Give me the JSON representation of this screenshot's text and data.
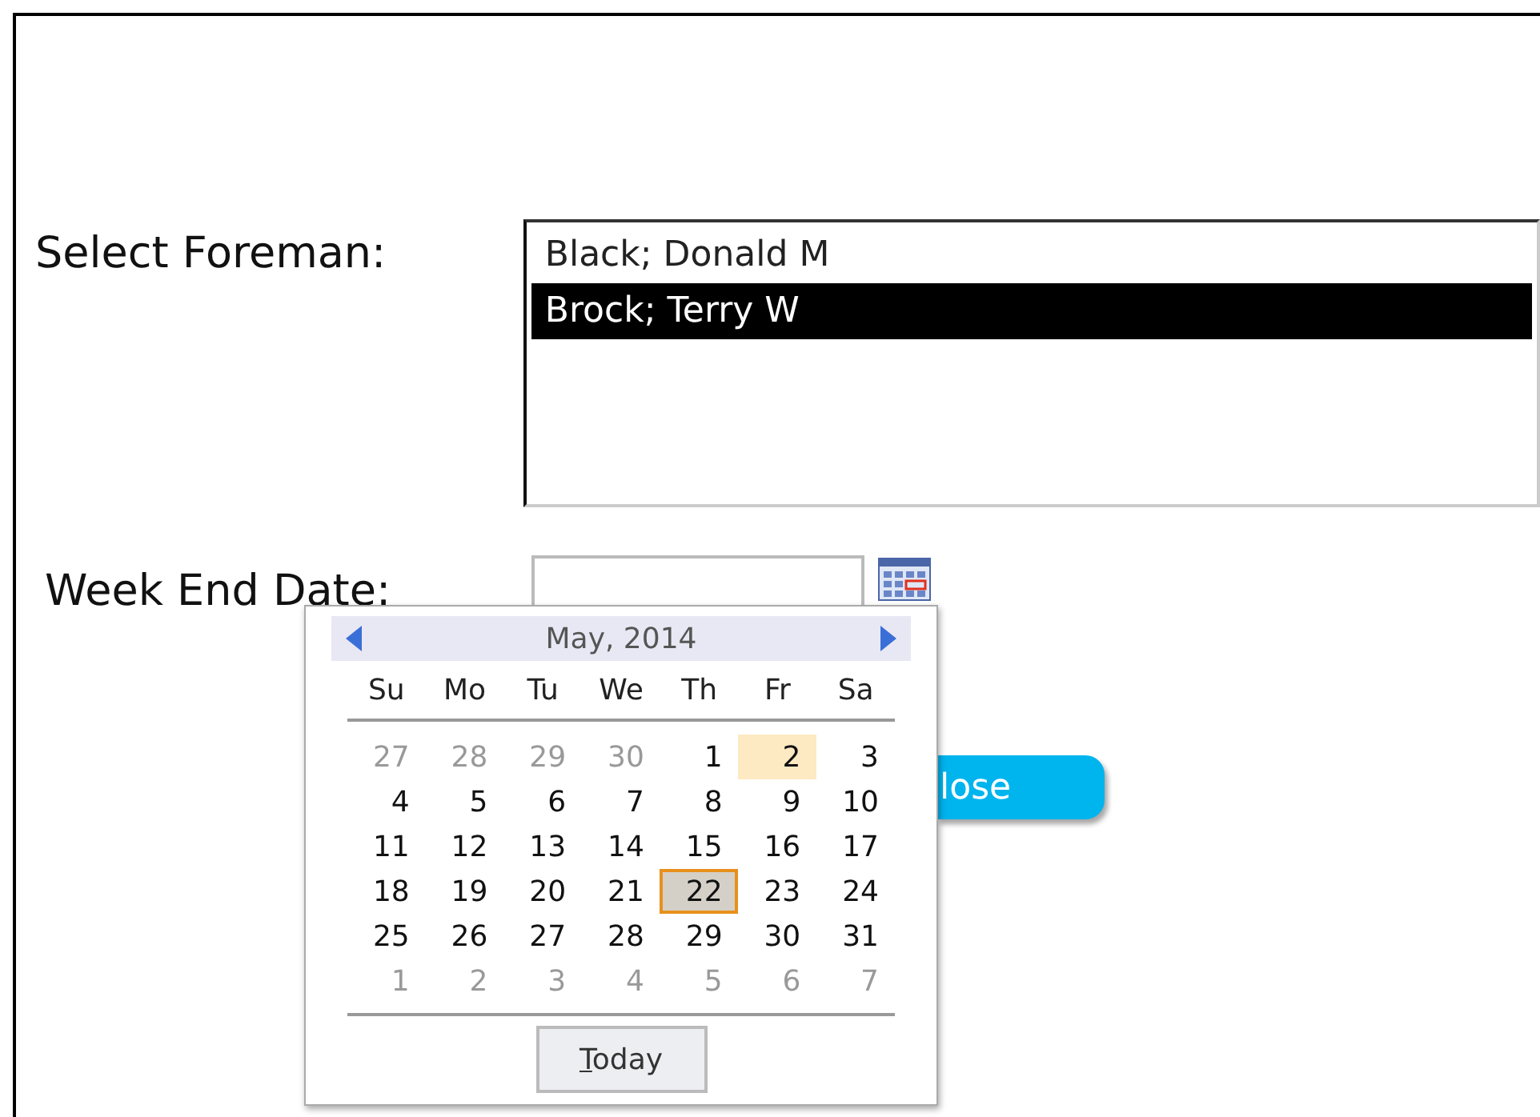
{
  "form": {
    "foreman_label": "Select Foreman:",
    "foreman_list": [
      {
        "text": "Black; Donald M",
        "selected": false
      },
      {
        "text": "Brock; Terry W",
        "selected": true
      }
    ],
    "week_end_label": "Week End Date:",
    "close_button": "lose"
  },
  "calendar": {
    "month": "May, 2014",
    "weekdays": [
      "Su",
      "Mo",
      "Tu",
      "We",
      "Th",
      "Fr",
      "Sa"
    ],
    "weeks": [
      [
        {
          "day": "27",
          "kind": "other",
          "selected": false
        },
        {
          "day": "28",
          "kind": "other",
          "selected": false
        },
        {
          "day": "29",
          "kind": "other",
          "selected": false
        },
        {
          "day": "30",
          "kind": "other",
          "selected": false
        },
        {
          "day": "1",
          "kind": "day",
          "selected": false
        },
        {
          "day": "2",
          "kind": "today",
          "selected": false
        },
        {
          "day": "3",
          "kind": "day",
          "selected": false
        }
      ],
      [
        {
          "day": "4",
          "kind": "day",
          "selected": false
        },
        {
          "day": "5",
          "kind": "day",
          "selected": false
        },
        {
          "day": "6",
          "kind": "day",
          "selected": false
        },
        {
          "day": "7",
          "kind": "day",
          "selected": false
        },
        {
          "day": "8",
          "kind": "day",
          "selected": false
        },
        {
          "day": "9",
          "kind": "day",
          "selected": false
        },
        {
          "day": "10",
          "kind": "day",
          "selected": false
        }
      ],
      [
        {
          "day": "11",
          "kind": "day",
          "selected": false
        },
        {
          "day": "12",
          "kind": "day",
          "selected": false
        },
        {
          "day": "13",
          "kind": "day",
          "selected": false
        },
        {
          "day": "14",
          "kind": "day",
          "selected": false
        },
        {
          "day": "15",
          "kind": "day",
          "selected": false
        },
        {
          "day": "16",
          "kind": "day",
          "selected": false
        },
        {
          "day": "17",
          "kind": "day",
          "selected": false
        }
      ],
      [
        {
          "day": "18",
          "kind": "day",
          "selected": false
        },
        {
          "day": "19",
          "kind": "day",
          "selected": false
        },
        {
          "day": "20",
          "kind": "day",
          "selected": false
        },
        {
          "day": "21",
          "kind": "day",
          "selected": false
        },
        {
          "day": "22",
          "kind": "day",
          "selected": true
        },
        {
          "day": "23",
          "kind": "day",
          "selected": false
        },
        {
          "day": "24",
          "kind": "day",
          "selected": false
        }
      ],
      [
        {
          "day": "25",
          "kind": "day",
          "selected": false
        },
        {
          "day": "26",
          "kind": "day",
          "selected": false
        },
        {
          "day": "27",
          "kind": "day",
          "selected": false
        },
        {
          "day": "28",
          "kind": "day",
          "selected": false
        },
        {
          "day": "29",
          "kind": "day",
          "selected": false
        },
        {
          "day": "30",
          "kind": "day",
          "selected": false
        },
        {
          "day": "31",
          "kind": "day",
          "selected": false
        }
      ],
      [
        {
          "day": "1",
          "kind": "other",
          "selected": false
        },
        {
          "day": "2",
          "kind": "other",
          "selected": false
        },
        {
          "day": "3",
          "kind": "other",
          "selected": false
        },
        {
          "day": "4",
          "kind": "other",
          "selected": false
        },
        {
          "day": "5",
          "kind": "other",
          "selected": false
        },
        {
          "day": "6",
          "kind": "other",
          "selected": false
        },
        {
          "day": "7",
          "kind": "other",
          "selected": false
        }
      ]
    ],
    "today_button": "Today"
  }
}
